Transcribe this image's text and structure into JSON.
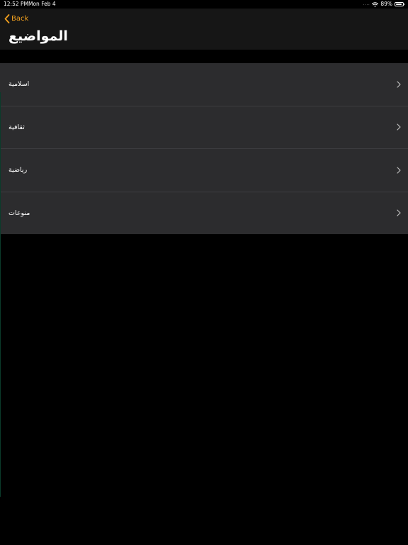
{
  "status_bar": {
    "time": "12:52 PM",
    "date": "Mon Feb 4",
    "signal": "....",
    "battery_percent": "89%",
    "battery_level": 0.89,
    "icons": [
      "signal-dots-icon",
      "wifi-icon",
      "battery-icon"
    ]
  },
  "nav": {
    "back_label": "Back",
    "back_icon": "chevron-left-icon",
    "title": "المواضيع"
  },
  "list": {
    "items": [
      {
        "label": "اسلامية",
        "icon": "chevron-right-icon"
      },
      {
        "label": "ثقافية",
        "icon": "chevron-right-icon"
      },
      {
        "label": "رياضية",
        "icon": "chevron-right-icon"
      },
      {
        "label": "منوعات",
        "icon": "chevron-right-icon"
      }
    ]
  },
  "colors": {
    "accent": "#f2a01e",
    "background": "#000000",
    "nav_background": "#161616",
    "cell_background": "#2c2c2e",
    "separator": "#3d3d40",
    "text": "#ffffff"
  }
}
